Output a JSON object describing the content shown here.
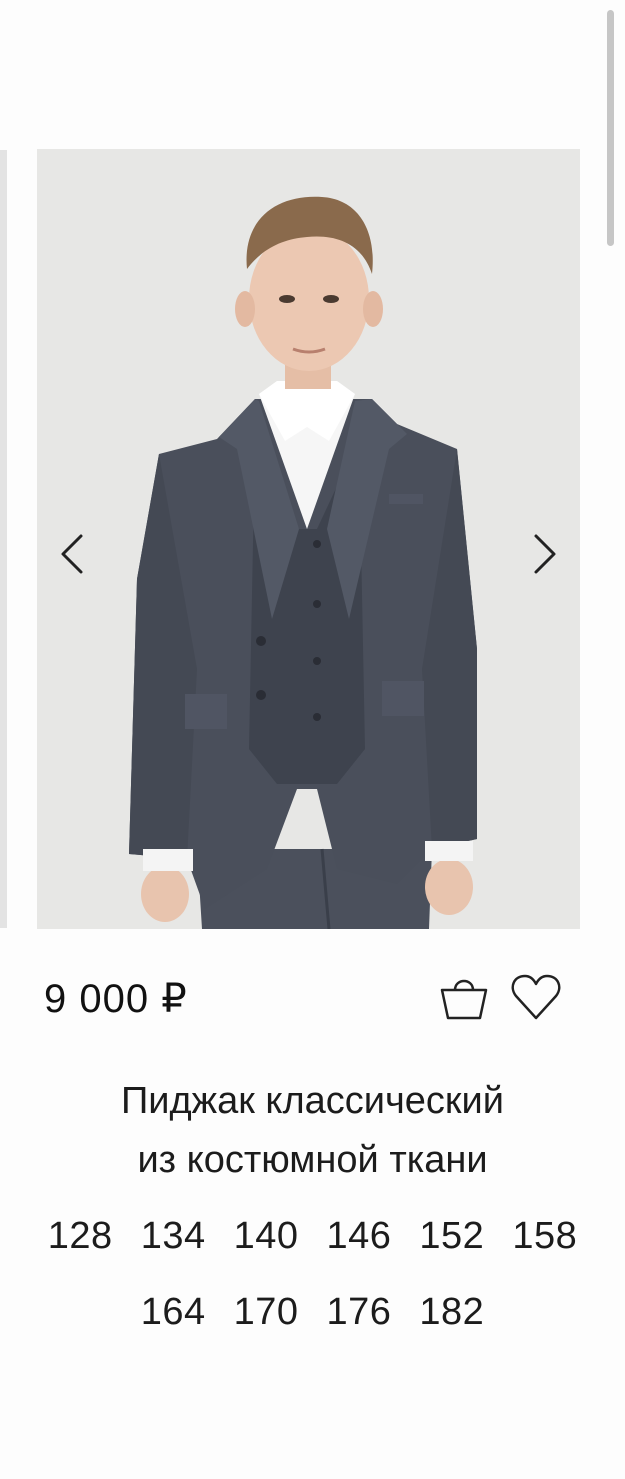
{
  "product": {
    "image_alt": "Boy wearing a grey three-piece suit: jacket, vest and white shirt",
    "price": "9 000 ₽",
    "title_lines": [
      "Пиджак классический",
      "из костюмной ткани"
    ],
    "sizes": [
      "128",
      "134",
      "140",
      "146",
      "152",
      "158",
      "164",
      "170",
      "176",
      "182"
    ]
  },
  "icons": {
    "prev": "chevron-left-icon",
    "next": "chevron-right-icon",
    "cart": "shopping-bag-icon",
    "favorite": "heart-icon"
  },
  "colors": {
    "background": "#fdfdfd",
    "photo_background": "#e7e7e5",
    "suit": "#4a4f5b",
    "text": "#1c1c1c"
  }
}
